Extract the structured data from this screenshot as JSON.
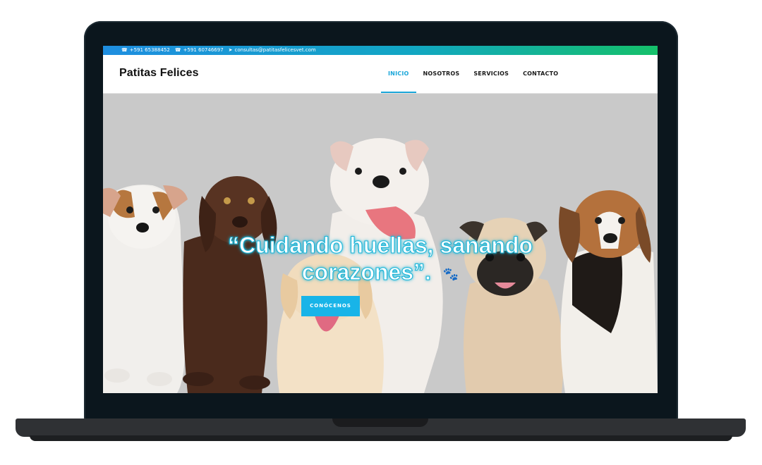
{
  "topbar": {
    "phone1": "+591 65388452",
    "phone2": "+591 60746697",
    "email": "consultas@patitasfelicesvet.com",
    "phone_icon": "phone-icon",
    "mail_icon": "paper-plane-icon"
  },
  "brand": {
    "name": "Patitas Felices"
  },
  "nav": {
    "items": [
      {
        "label": "INICIO",
        "active": true
      },
      {
        "label": "NOSOTROS",
        "active": false
      },
      {
        "label": "SERVICIOS",
        "active": false
      },
      {
        "label": "CONTACTO",
        "active": false
      }
    ]
  },
  "hero": {
    "line1": "“Cuidando huellas, sanando",
    "line2": "corazones”.",
    "paw_icon": "paw-prints-icon",
    "cta_label": "CONÓCENOS",
    "image_subject": "puppies-photo"
  },
  "colors": {
    "accent": "#1aa6d9",
    "cta": "#18b4e8",
    "topbar_start": "#1e8ee0",
    "topbar_end": "#15c06a",
    "hero_bg": "#c9c9c9"
  }
}
